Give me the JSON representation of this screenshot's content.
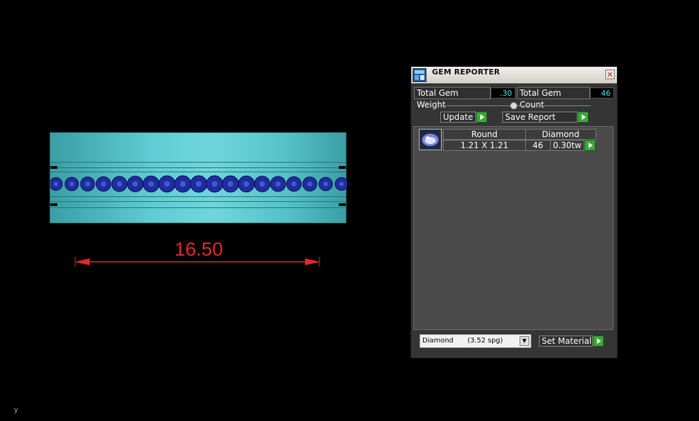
{
  "viewport": {
    "dimension_label": "16.50",
    "axis_label": "y",
    "ring_color": "#5fcdd3",
    "gem_color": "#1f2d9c",
    "dimension_color": "#e0282a"
  },
  "panel": {
    "title": "GEM REPORTER",
    "close_glyph": "✕",
    "total_gem_weight_label": "Total Gem Weight",
    "total_gem_weight_value": ".30",
    "total_gem_count_label": "Total Gem Count",
    "total_gem_count_value": "46",
    "update_label": "Update",
    "save_report_label": "Save Report",
    "gem_rows": [
      {
        "shape": "Round",
        "material": "Diamond",
        "size": "1.21 X 1.21",
        "count": "46",
        "weight": "0.30tw"
      }
    ],
    "material_select_name": "Diamond",
    "material_select_spg": "(3.52 spg)",
    "set_material_label": "Set Material",
    "accent_green": "#3aa83a",
    "value_cyan": "#57e3e3"
  }
}
